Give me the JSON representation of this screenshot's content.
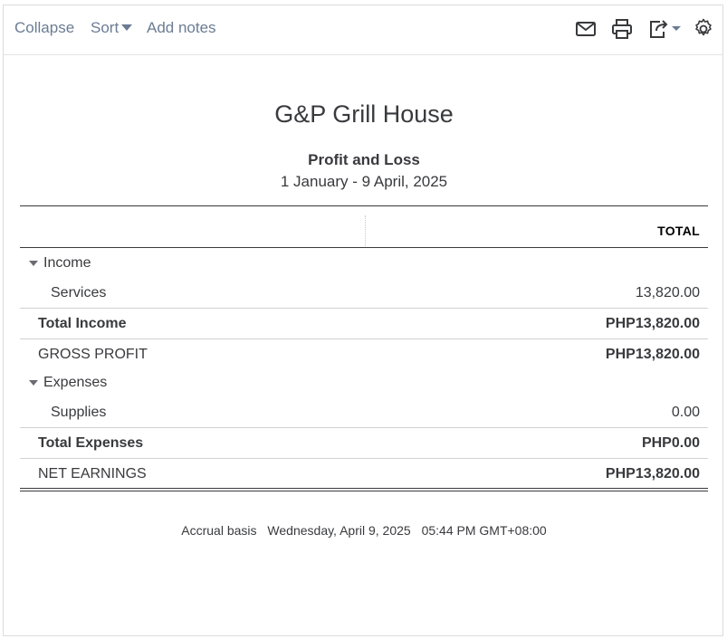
{
  "toolbar": {
    "collapse_label": "Collapse",
    "sort_label": "Sort",
    "add_notes_label": "Add notes",
    "icons": [
      "email-icon",
      "print-icon",
      "export-icon",
      "settings-icon"
    ]
  },
  "report": {
    "company": "G&P Grill House",
    "title": "Profit and Loss",
    "date_range": "1 January - 9 April, 2025",
    "column_header": "TOTAL",
    "rows": [
      {
        "label": "Income",
        "amount": ""
      },
      {
        "label": "Services",
        "amount": "13,820.00"
      },
      {
        "label": "Total Income",
        "amount": "PHP13,820.00"
      },
      {
        "label": "GROSS PROFIT",
        "amount": "PHP13,820.00"
      },
      {
        "label": "Expenses",
        "amount": ""
      },
      {
        "label": "Supplies",
        "amount": "0.00"
      },
      {
        "label": "Total Expenses",
        "amount": "PHP0.00"
      },
      {
        "label": "NET EARNINGS",
        "amount": "PHP13,820.00"
      }
    ],
    "footer": {
      "basis": "Accrual basis",
      "timestamp": "Wednesday, April 9, 2025",
      "time": "05:44 PM GMT+08:00"
    }
  },
  "colors": {
    "link": "#6b7c93",
    "text": "#393a3d"
  }
}
